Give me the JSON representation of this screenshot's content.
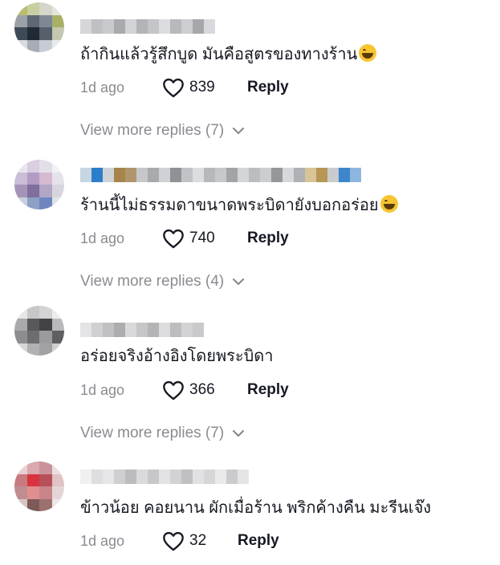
{
  "comments": [
    {
      "text": "ถ้ากินแล้วรู้สึกบูด มันคือสูตรของทางร้าน",
      "emoji_icon": "tears-of-joy-emoji-icon",
      "time": "1d ago",
      "likes": "839",
      "reply_label": "Reply",
      "more_replies": "View more replies (7)"
    },
    {
      "text": "ร้านนี้ไม่ธรรมดาขนาดพระบิดายังบอกอร่อย",
      "emoji_icon": "tears-of-joy-emoji-icon",
      "time": "1d ago",
      "likes": "740",
      "reply_label": "Reply",
      "more_replies": "View more replies (4)"
    },
    {
      "text": "อร่อยจริงอ้างอิงโดยพระบิดา",
      "time": "1d ago",
      "likes": "366",
      "reply_label": "Reply",
      "more_replies": "View more replies (7)"
    },
    {
      "text": "ข้าวน้อย คอยนาน ผักเมื่อร้าน พริกค้างคืน มะรีนเจ๊ง",
      "time": "1d ago",
      "likes": "32",
      "reply_label": "Reply"
    }
  ],
  "colors": {
    "text": "#161823",
    "muted": "#8a8b91",
    "background": "#ffffff"
  },
  "icons": {
    "like": "heart-outline-icon",
    "expand": "chevron-down-icon"
  }
}
